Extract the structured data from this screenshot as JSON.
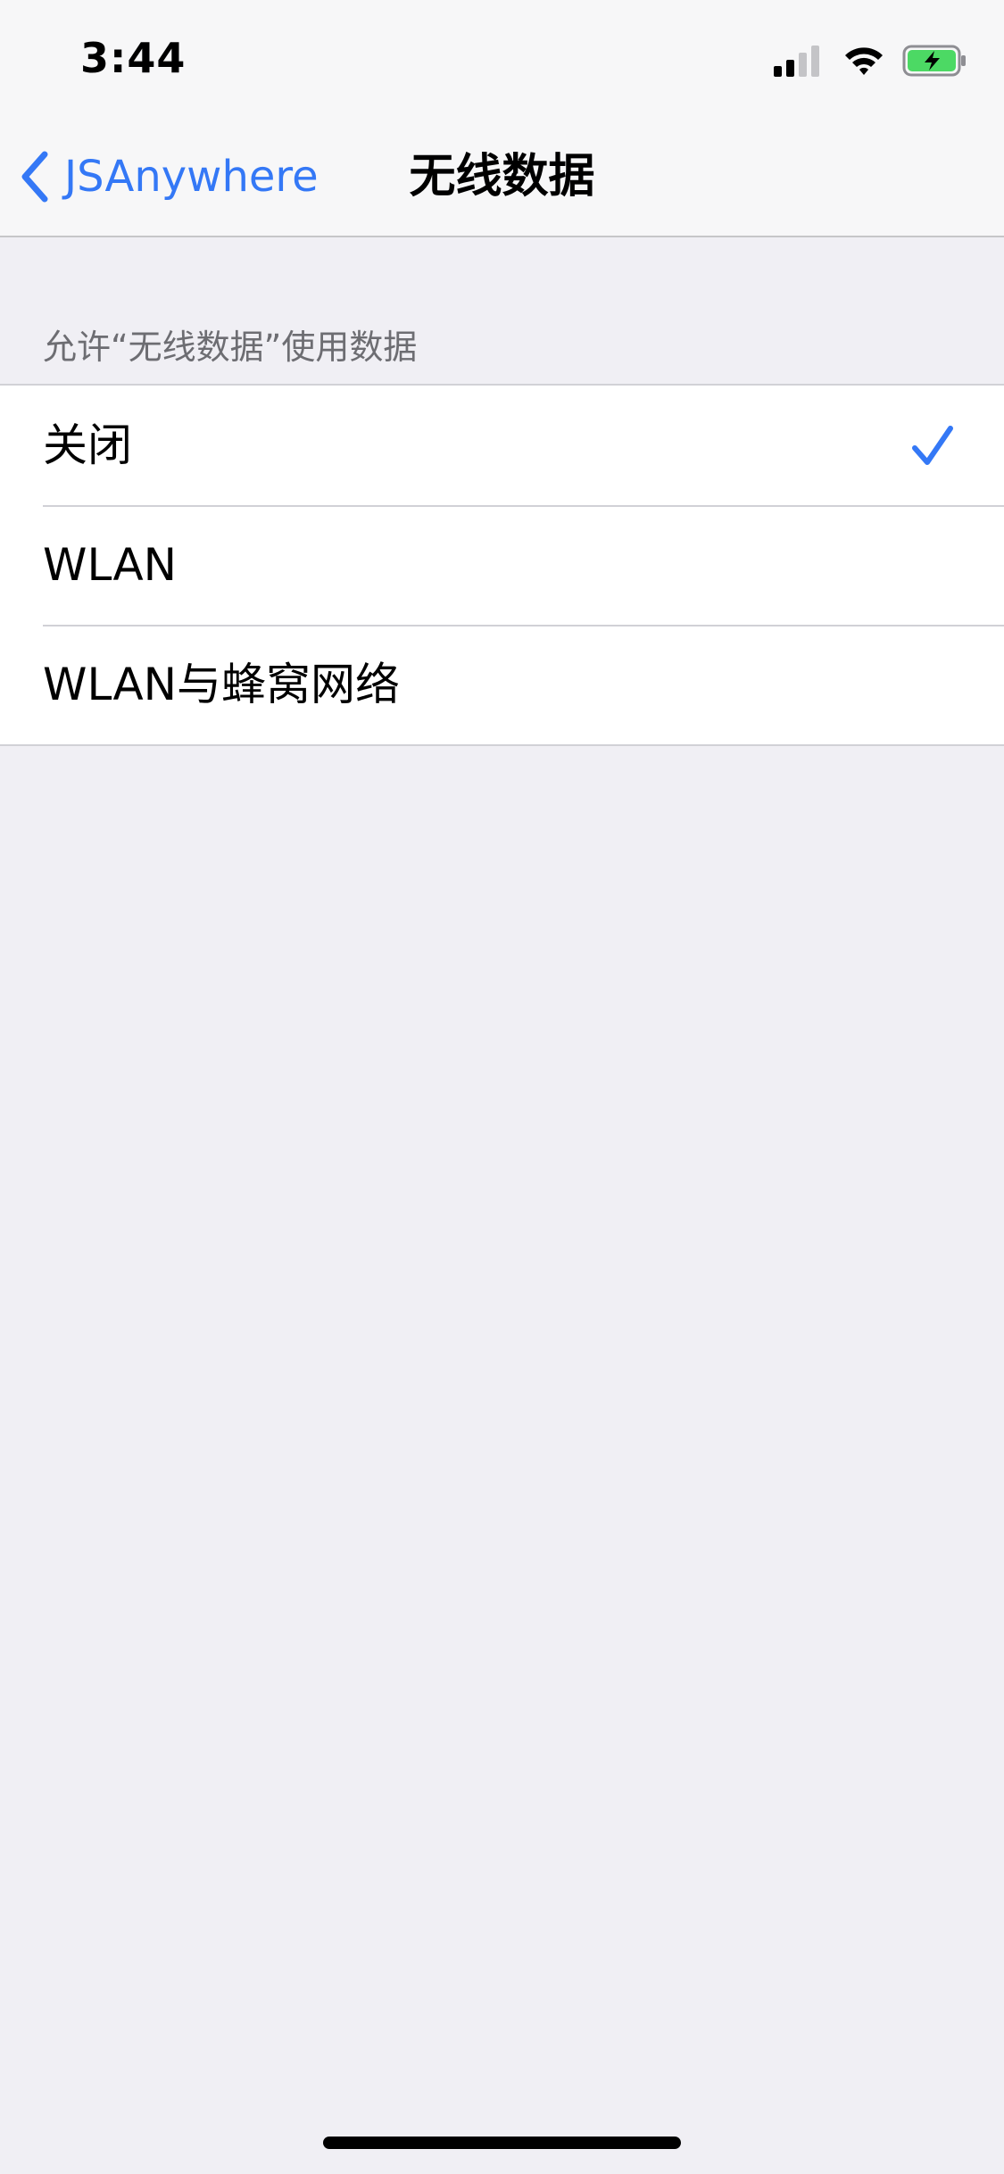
{
  "status_bar": {
    "time": "3:44",
    "icons": [
      "cellular-signal-icon",
      "wifi-icon",
      "battery-charging-icon"
    ],
    "battery_color": "#4cd964"
  },
  "nav": {
    "back_label": "JSAnywhere",
    "title": "无线数据"
  },
  "section": {
    "header": "允许“无线数据”使用数据",
    "options": [
      {
        "label": "关闭",
        "selected": true
      },
      {
        "label": "WLAN",
        "selected": false
      },
      {
        "label": "WLAN与蜂窝网络",
        "selected": false
      }
    ]
  },
  "colors": {
    "accent": "#3478f6",
    "background": "#f0eff4",
    "secondary_text": "#6d6d72"
  }
}
